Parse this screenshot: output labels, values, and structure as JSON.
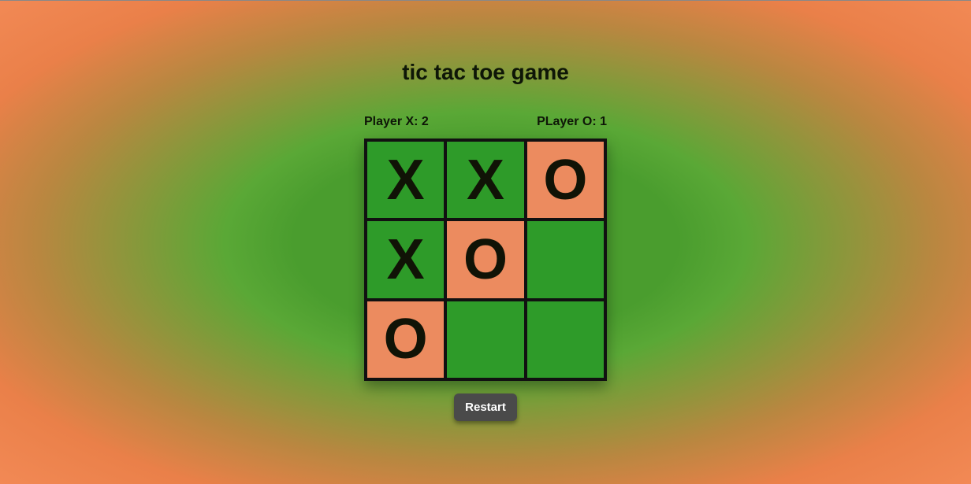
{
  "title": "tic tac toe game",
  "score": {
    "x_label": "Player X: 2",
    "o_label": "PLayer O: 1"
  },
  "board": {
    "cells": [
      {
        "mark": "X",
        "color": "green"
      },
      {
        "mark": "X",
        "color": "green"
      },
      {
        "mark": "O",
        "color": "orange"
      },
      {
        "mark": "X",
        "color": "green"
      },
      {
        "mark": "O",
        "color": "orange"
      },
      {
        "mark": "",
        "color": "green"
      },
      {
        "mark": "O",
        "color": "orange"
      },
      {
        "mark": "",
        "color": "green"
      },
      {
        "mark": "",
        "color": "green"
      }
    ]
  },
  "restart_label": "Restart"
}
